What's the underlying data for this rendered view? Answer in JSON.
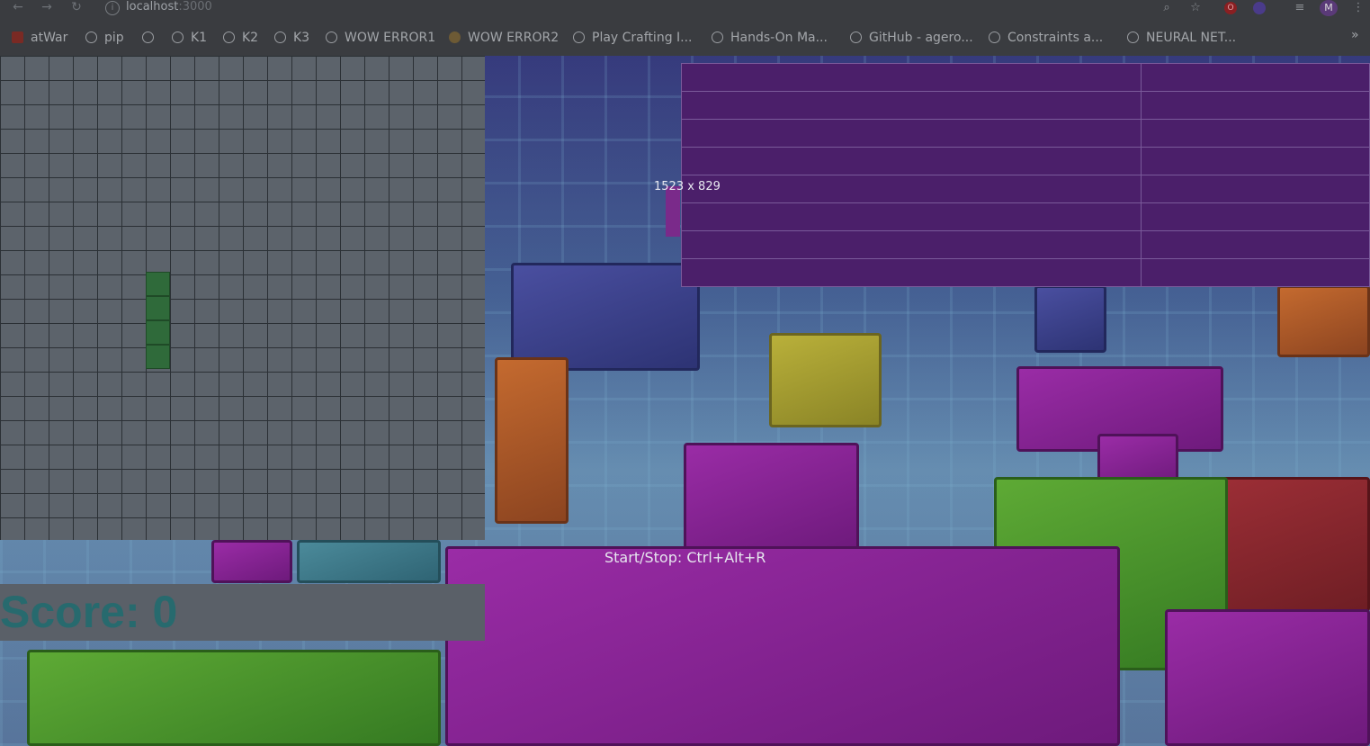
{
  "browser": {
    "url_host": "localhost",
    "url_port": ":3000",
    "avatar_letter": "M",
    "bookmarks": [
      {
        "label": "atWar",
        "icon": "atwar-icon"
      },
      {
        "label": "pip",
        "icon": "globe-icon"
      },
      {
        "label": "",
        "icon": "globe-icon"
      },
      {
        "label": "K1",
        "icon": "globe-icon"
      },
      {
        "label": "K2",
        "icon": "globe-icon"
      },
      {
        "label": "K3",
        "icon": "globe-icon"
      },
      {
        "label": "WOW ERROR1",
        "icon": "globe-icon"
      },
      {
        "label": "WOW ERROR2",
        "icon": "wow-icon"
      },
      {
        "label": "Play Crafting I...",
        "icon": "globe-icon"
      },
      {
        "label": "Hands-On Ma...",
        "icon": "globe-icon"
      },
      {
        "label": "GitHub - agero...",
        "icon": "globe-icon"
      },
      {
        "label": "Constraints a...",
        "icon": "globe-icon"
      },
      {
        "label": "NEURAL NET...",
        "icon": "globe-icon"
      }
    ],
    "more_label": "»"
  },
  "game": {
    "score_label": "Score: 0",
    "controls_hint": "Start/Stop: Ctrl+Alt+R",
    "dimensions_overlay": "1523 x 829",
    "board_grid": {
      "columns": 20,
      "rows": 20
    },
    "active_piece": {
      "type": "I",
      "color": "#2f6a3a",
      "column": 6,
      "row": 9,
      "length": 4,
      "orientation": "vertical"
    }
  },
  "stats_table": {
    "rows": 8
  }
}
